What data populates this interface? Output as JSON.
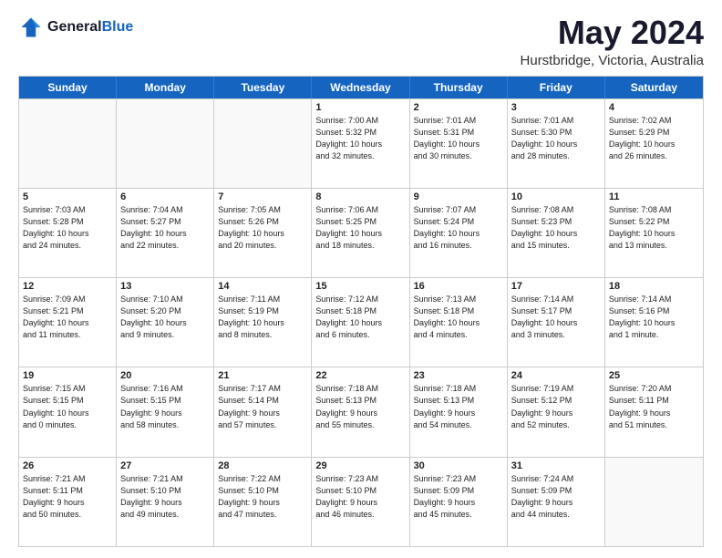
{
  "header": {
    "logo_general": "General",
    "logo_blue": "Blue",
    "title": "May 2024",
    "subtitle": "Hurstbridge, Victoria, Australia"
  },
  "days_of_week": [
    "Sunday",
    "Monday",
    "Tuesday",
    "Wednesday",
    "Thursday",
    "Friday",
    "Saturday"
  ],
  "weeks": [
    [
      {
        "day": "",
        "info": ""
      },
      {
        "day": "",
        "info": ""
      },
      {
        "day": "",
        "info": ""
      },
      {
        "day": "1",
        "info": "Sunrise: 7:00 AM\nSunset: 5:32 PM\nDaylight: 10 hours\nand 32 minutes."
      },
      {
        "day": "2",
        "info": "Sunrise: 7:01 AM\nSunset: 5:31 PM\nDaylight: 10 hours\nand 30 minutes."
      },
      {
        "day": "3",
        "info": "Sunrise: 7:01 AM\nSunset: 5:30 PM\nDaylight: 10 hours\nand 28 minutes."
      },
      {
        "day": "4",
        "info": "Sunrise: 7:02 AM\nSunset: 5:29 PM\nDaylight: 10 hours\nand 26 minutes."
      }
    ],
    [
      {
        "day": "5",
        "info": "Sunrise: 7:03 AM\nSunset: 5:28 PM\nDaylight: 10 hours\nand 24 minutes."
      },
      {
        "day": "6",
        "info": "Sunrise: 7:04 AM\nSunset: 5:27 PM\nDaylight: 10 hours\nand 22 minutes."
      },
      {
        "day": "7",
        "info": "Sunrise: 7:05 AM\nSunset: 5:26 PM\nDaylight: 10 hours\nand 20 minutes."
      },
      {
        "day": "8",
        "info": "Sunrise: 7:06 AM\nSunset: 5:25 PM\nDaylight: 10 hours\nand 18 minutes."
      },
      {
        "day": "9",
        "info": "Sunrise: 7:07 AM\nSunset: 5:24 PM\nDaylight: 10 hours\nand 16 minutes."
      },
      {
        "day": "10",
        "info": "Sunrise: 7:08 AM\nSunset: 5:23 PM\nDaylight: 10 hours\nand 15 minutes."
      },
      {
        "day": "11",
        "info": "Sunrise: 7:08 AM\nSunset: 5:22 PM\nDaylight: 10 hours\nand 13 minutes."
      }
    ],
    [
      {
        "day": "12",
        "info": "Sunrise: 7:09 AM\nSunset: 5:21 PM\nDaylight: 10 hours\nand 11 minutes."
      },
      {
        "day": "13",
        "info": "Sunrise: 7:10 AM\nSunset: 5:20 PM\nDaylight: 10 hours\nand 9 minutes."
      },
      {
        "day": "14",
        "info": "Sunrise: 7:11 AM\nSunset: 5:19 PM\nDaylight: 10 hours\nand 8 minutes."
      },
      {
        "day": "15",
        "info": "Sunrise: 7:12 AM\nSunset: 5:18 PM\nDaylight: 10 hours\nand 6 minutes."
      },
      {
        "day": "16",
        "info": "Sunrise: 7:13 AM\nSunset: 5:18 PM\nDaylight: 10 hours\nand 4 minutes."
      },
      {
        "day": "17",
        "info": "Sunrise: 7:14 AM\nSunset: 5:17 PM\nDaylight: 10 hours\nand 3 minutes."
      },
      {
        "day": "18",
        "info": "Sunrise: 7:14 AM\nSunset: 5:16 PM\nDaylight: 10 hours\nand 1 minute."
      }
    ],
    [
      {
        "day": "19",
        "info": "Sunrise: 7:15 AM\nSunset: 5:15 PM\nDaylight: 10 hours\nand 0 minutes."
      },
      {
        "day": "20",
        "info": "Sunrise: 7:16 AM\nSunset: 5:15 PM\nDaylight: 9 hours\nand 58 minutes."
      },
      {
        "day": "21",
        "info": "Sunrise: 7:17 AM\nSunset: 5:14 PM\nDaylight: 9 hours\nand 57 minutes."
      },
      {
        "day": "22",
        "info": "Sunrise: 7:18 AM\nSunset: 5:13 PM\nDaylight: 9 hours\nand 55 minutes."
      },
      {
        "day": "23",
        "info": "Sunrise: 7:18 AM\nSunset: 5:13 PM\nDaylight: 9 hours\nand 54 minutes."
      },
      {
        "day": "24",
        "info": "Sunrise: 7:19 AM\nSunset: 5:12 PM\nDaylight: 9 hours\nand 52 minutes."
      },
      {
        "day": "25",
        "info": "Sunrise: 7:20 AM\nSunset: 5:11 PM\nDaylight: 9 hours\nand 51 minutes."
      }
    ],
    [
      {
        "day": "26",
        "info": "Sunrise: 7:21 AM\nSunset: 5:11 PM\nDaylight: 9 hours\nand 50 minutes."
      },
      {
        "day": "27",
        "info": "Sunrise: 7:21 AM\nSunset: 5:10 PM\nDaylight: 9 hours\nand 49 minutes."
      },
      {
        "day": "28",
        "info": "Sunrise: 7:22 AM\nSunset: 5:10 PM\nDaylight: 9 hours\nand 47 minutes."
      },
      {
        "day": "29",
        "info": "Sunrise: 7:23 AM\nSunset: 5:10 PM\nDaylight: 9 hours\nand 46 minutes."
      },
      {
        "day": "30",
        "info": "Sunrise: 7:23 AM\nSunset: 5:09 PM\nDaylight: 9 hours\nand 45 minutes."
      },
      {
        "day": "31",
        "info": "Sunrise: 7:24 AM\nSunset: 5:09 PM\nDaylight: 9 hours\nand 44 minutes."
      },
      {
        "day": "",
        "info": ""
      }
    ]
  ]
}
